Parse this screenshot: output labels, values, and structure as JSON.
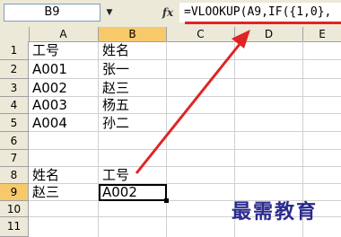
{
  "formula_bar": {
    "name_box": "B9",
    "dropdown_icon": "triangle-down",
    "fx_label": "fx",
    "formula": "=VLOOKUP(A9,IF({1,0},",
    "underline_color": "#e02424"
  },
  "columns": [
    "A",
    "B",
    "C",
    "D",
    "E"
  ],
  "rows": [
    "1",
    "2",
    "3",
    "4",
    "5",
    "6",
    "7",
    "8",
    "9",
    "10",
    "11"
  ],
  "selection": {
    "column": "B",
    "row": "9",
    "highlight_color": "#f7c96b"
  },
  "cells": {
    "A1": "工号",
    "B1": "姓名",
    "A2": "A001",
    "B2": "张一",
    "A3": "A002",
    "B3": "赵三",
    "A4": "A003",
    "B4": "杨五",
    "A5": "A004",
    "B5": "孙二",
    "A8": "姓名",
    "B8": "工号",
    "A9": "赵三",
    "B9": "A002"
  },
  "annotation": {
    "arrow_color": "#e02424"
  },
  "watermark": "最需教育"
}
